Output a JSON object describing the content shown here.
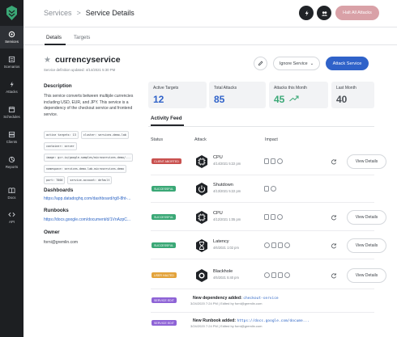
{
  "sidebar": {
    "items": [
      {
        "label": "Services",
        "icon": "services-icon",
        "active": true
      },
      {
        "label": "Scenarios",
        "icon": "scenarios-icon"
      },
      {
        "label": "Attacks",
        "icon": "attacks-icon"
      },
      {
        "label": "Schedules",
        "icon": "calendar-icon"
      },
      {
        "label": "Clients",
        "icon": "clients-icon"
      },
      {
        "label": "Reports",
        "icon": "reports-icon"
      },
      {
        "label": "Docs",
        "icon": "docs-icon"
      },
      {
        "label": "API",
        "icon": "code-icon"
      }
    ]
  },
  "header": {
    "breadcrumb_root": "Services",
    "breadcrumb_sep": ">",
    "breadcrumb_current": "Service Details",
    "halt_label": "Halt All Attacks"
  },
  "tabs": [
    {
      "label": "Details",
      "active": true
    },
    {
      "label": "Targets"
    }
  ],
  "service": {
    "name": "currencyservice",
    "updated": "Service definition updated: 4/14/2021 5:30 PM",
    "description_heading": "Description",
    "description": "This service converts between multiple currencies including USD, EUR, and JPY. This service is a dependency of the checkout service and frontend service.",
    "tags": [
      [
        "active targets: 13",
        "cluster: services-demo-lab"
      ],
      [
        "container: server"
      ],
      [
        "image: gcr.io/google-samples/microservices-demo/..."
      ],
      [
        "namespace: services-demo-lab-microservices-demo"
      ],
      [
        "port: 7000",
        "service-account: default"
      ]
    ],
    "dashboards_heading": "Dashboards",
    "dashboard_link": "https://app.datadoghq.com/dashboard/rg8-8ht-...",
    "runbooks_heading": "Runbooks",
    "runbook_link": "https://docs.google.com/document/d/1VnAzpC...",
    "owner_heading": "Owner",
    "owner": "forni@gremlin.com"
  },
  "actions": {
    "ignore_label": "Ignore Service",
    "attack_label": "Attack Service"
  },
  "stats": [
    {
      "label": "Active Targets",
      "value": "12",
      "color": "#2f62c9"
    },
    {
      "label": "Total Attacks",
      "value": "85",
      "color": "#2f62c9"
    },
    {
      "label": "Attacks this Month",
      "value": "45",
      "color": "#3aa876",
      "trend": "up"
    },
    {
      "label": "Last Month",
      "value": "40",
      "color": "#4a4f55"
    }
  ],
  "feed": {
    "tab_label": "Activity Feed",
    "col_status": "Status",
    "col_attack": "Attack",
    "col_impact": "Impact",
    "view_label": "View Details",
    "rows": [
      {
        "status": "CLIENT ABORTED",
        "status_color": "#c9514f",
        "attack": "CPU",
        "time": "4/14/2021 5:22 pm",
        "icon": "cpu-attack-icon"
      },
      {
        "status": "SUCCESSFUL",
        "status_color": "#3aa876",
        "attack": "Shutdown",
        "time": "4/13/2021 5:22 pm",
        "icon": "shutdown-attack-icon"
      },
      {
        "status": "SUCCESSFUL",
        "status_color": "#3aa876",
        "attack": "CPU",
        "time": "4/12/2021 1:05 pm",
        "icon": "cpu-attack-icon"
      },
      {
        "status": "SUCCESSFUL",
        "status_color": "#3aa876",
        "attack": "Latency",
        "time": "4/6/2021 1:02 pm",
        "icon": "latency-attack-icon"
      },
      {
        "status": "USER HALTED",
        "status_color": "#e3a33b",
        "attack": "Blackhole",
        "time": "4/5/2021 5:40 pm",
        "icon": "blackhole-attack-icon"
      }
    ],
    "events": [
      {
        "badge": "SERVICE EDIT",
        "badge_color": "#8e63d6",
        "title": "New dependency added:",
        "code": "checkout-service",
        "sub": "3/24/2020 7:24 PM | Edited by forni@gremlin.com"
      },
      {
        "badge": "SERVICE EDIT",
        "badge_color": "#8e63d6",
        "title": "New Runbook added:",
        "code": "https://docs.google.com/docume...",
        "sub": "3/24/2020 7:24 PM | Edited by forni@gremlin.com"
      }
    ]
  }
}
